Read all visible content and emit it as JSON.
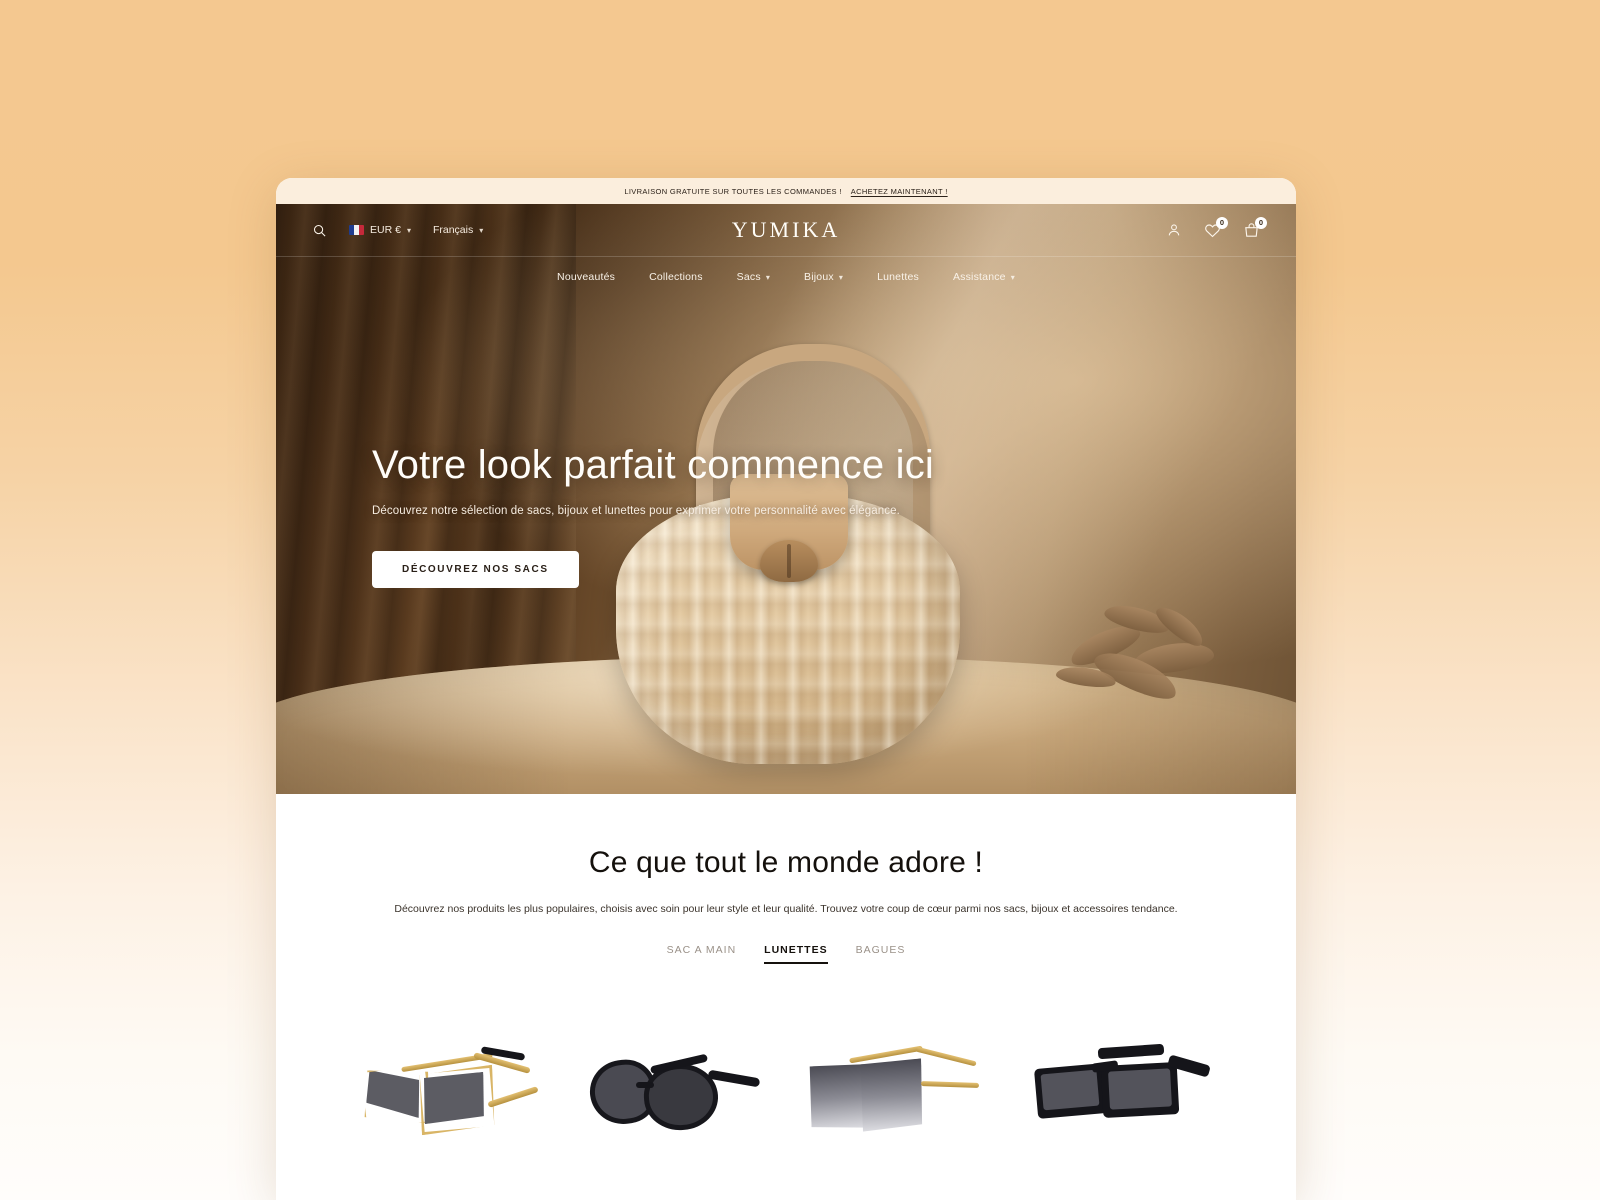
{
  "announcement": {
    "text": "LIVRAISON GRATUITE SUR TOUTES LES COMMANDES !",
    "link": "ACHETEZ MAINTENANT !"
  },
  "header": {
    "brand": "YUMIKA",
    "search_icon": "search-icon",
    "currency": "EUR €",
    "language": "Français",
    "account_icon": "person-icon",
    "wishlist_icon": "heart-icon",
    "wishlist_count": "0",
    "cart_icon": "bag-icon",
    "cart_count": "0"
  },
  "nav": {
    "items": [
      {
        "label": "Nouveautés",
        "has_dropdown": false
      },
      {
        "label": "Collections",
        "has_dropdown": false
      },
      {
        "label": "Sacs",
        "has_dropdown": true
      },
      {
        "label": "Bijoux",
        "has_dropdown": true
      },
      {
        "label": "Lunettes",
        "has_dropdown": false
      },
      {
        "label": "Assistance",
        "has_dropdown": true
      }
    ]
  },
  "hero": {
    "title": "Votre look parfait commence ici",
    "subtitle": "Découvrez notre sélection de sacs, bijoux et lunettes pour exprimer votre personnalité avec élégance.",
    "cta": "DÉCOUVREZ NOS SACS"
  },
  "popular": {
    "title": "Ce que tout le monde adore !",
    "subtitle": "Découvrez nos produits les plus populaires, choisis avec soin pour leur style et leur qualité. Trouvez votre coup de cœur parmi nos sacs, bijoux et accessoires tendance.",
    "tabs": [
      {
        "label": "SAC A MAIN",
        "active": false
      },
      {
        "label": "LUNETTES",
        "active": true
      },
      {
        "label": "BAGUES",
        "active": false
      }
    ],
    "products": [
      {
        "name": "angular-gold-frame-sunglasses"
      },
      {
        "name": "black-oversized-round-sunglasses"
      },
      {
        "name": "square-gradient-rimless-sunglasses"
      },
      {
        "name": "black-rectangular-sunglasses"
      }
    ]
  },
  "colors": {
    "page_background_top": "#f4c890",
    "page_background_bottom": "#fffdfb",
    "announcement_background": "#fbeedd",
    "cta_background": "#ffffff",
    "accent_dark": "#15110d"
  }
}
